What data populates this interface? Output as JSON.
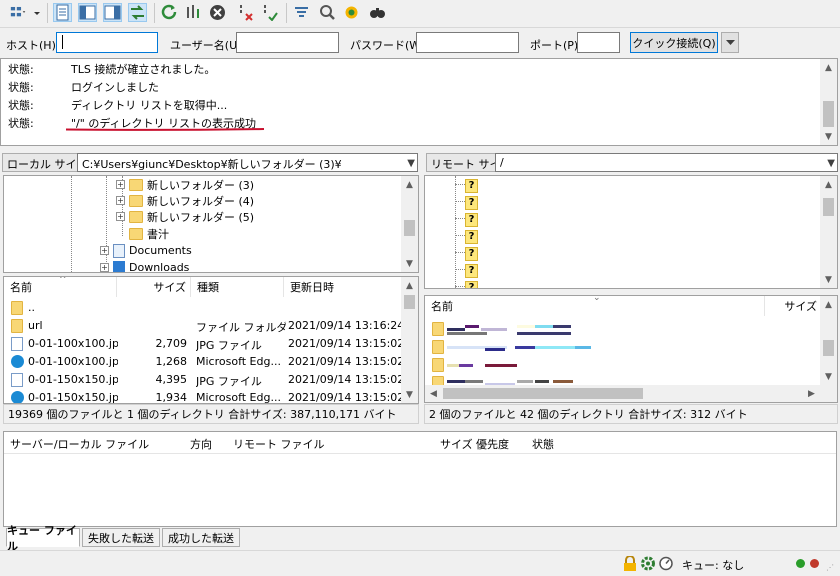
{
  "quickconnect": {
    "host_label": "ホスト(H):",
    "user_label": "ユーザー名(U):",
    "pass_label": "パスワード(W):",
    "port_label": "ポート(P):",
    "host_value": "",
    "user_value": "",
    "pass_value": "",
    "port_value": "",
    "connect_label": "クイック接続(Q)"
  },
  "log": [
    {
      "key": "状態:",
      "msg": "TLS 接続が確立されました。"
    },
    {
      "key": "状態:",
      "msg": "ログインしました"
    },
    {
      "key": "状態:",
      "msg": "ディレクトリ リストを取得中..."
    },
    {
      "key": "状態:",
      "msg": "\"/\" のディレクトリ リストの表示成功"
    }
  ],
  "colors": {
    "highlight_underline": "#c8102e",
    "accent": "#0078d7",
    "folder": "#f8d775"
  },
  "local": {
    "site_label": "ローカル サイト:",
    "site_path": "C:¥Users¥giunc¥Desktop¥新しいフォルダー (3)¥",
    "tree": [
      {
        "label": "新しいフォルダー (3)",
        "expander": "+",
        "icon": "folder"
      },
      {
        "label": "新しいフォルダー (4)",
        "expander": "+",
        "icon": "folder"
      },
      {
        "label": "新しいフォルダー (5)",
        "expander": "+",
        "icon": "folder"
      },
      {
        "label": "書汁",
        "expander": "",
        "icon": "folder"
      },
      {
        "label": "Documents",
        "expander": "+",
        "icon": "documents-icon"
      },
      {
        "label": "Downloads",
        "expander": "+",
        "icon": "downloads-icon"
      }
    ],
    "columns": {
      "name": "名前",
      "size": "サイズ",
      "type": "種類",
      "modified": "更新日時"
    },
    "files": [
      {
        "name": "..",
        "size": "",
        "type": "",
        "modified": "",
        "icon": "folder"
      },
      {
        "name": "url",
        "size": "",
        "type": "ファイル フォルダー",
        "modified": "2021/09/14 13:16:24",
        "icon": "folder"
      },
      {
        "name": "0-01-100x100.jpg",
        "size": "2,709",
        "type": "JPG ファイル",
        "modified": "2021/09/14 13:15:02",
        "icon": "image"
      },
      {
        "name": "0-01-100x100.jp...",
        "size": "1,268",
        "type": "Microsoft Edg...",
        "modified": "2021/09/14 13:15:02",
        "icon": "edge"
      },
      {
        "name": "0-01-150x150.jpg",
        "size": "4,395",
        "type": "JPG ファイル",
        "modified": "2021/09/14 13:15:02",
        "icon": "image"
      },
      {
        "name": "0-01-150x150.jp...",
        "size": "1,934",
        "type": "Microsoft Edg...",
        "modified": "2021/09/14 13:15:02",
        "icon": "edge"
      }
    ],
    "status": "19369 個のファイルと 1 個のディレクトリ 合計サイズ: 387,110,171 バイト"
  },
  "remote": {
    "site_label": "リモート サイト:",
    "site_path": "/",
    "tree_count": 7,
    "columns": {
      "name": "名前",
      "size": "サイズ"
    },
    "file_rows": 4,
    "status": "2 個のファイルと 42 個のディレクトリ 合計サイズ: 312 バイト"
  },
  "queue": {
    "columns": {
      "server": "サーバー/ローカル ファイル",
      "direction": "方向",
      "remote": "リモート ファイル",
      "size": "サイズ",
      "priority": "優先度",
      "status": "状態"
    },
    "tabs": [
      "キュー ファイル",
      "失敗した転送",
      "成功した転送"
    ]
  },
  "statusbar": {
    "queue_text": "キュー: なし"
  }
}
